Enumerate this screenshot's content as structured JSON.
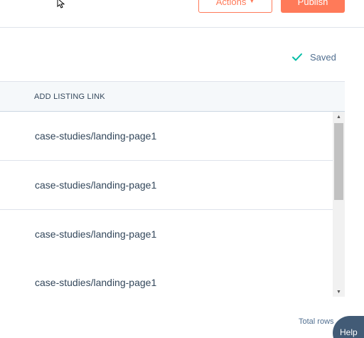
{
  "toolbar": {
    "actions_label": "Actions",
    "publish_label": "Publish"
  },
  "status": {
    "saved_label": "Saved",
    "saved_color": "#00bda5"
  },
  "table": {
    "column_header": "ADD LISTING LINK",
    "rows": [
      "case-studies/landing-page1",
      "case-studies/landing-page1",
      "case-studies/landing-page1",
      "case-studies/landing-page1"
    ]
  },
  "footer": {
    "total_rows_label": "Total rows",
    "help_label": "Help"
  },
  "colors": {
    "accent": "#ff7a59",
    "help": "#425b76",
    "header_bg": "#f5f8fa"
  }
}
